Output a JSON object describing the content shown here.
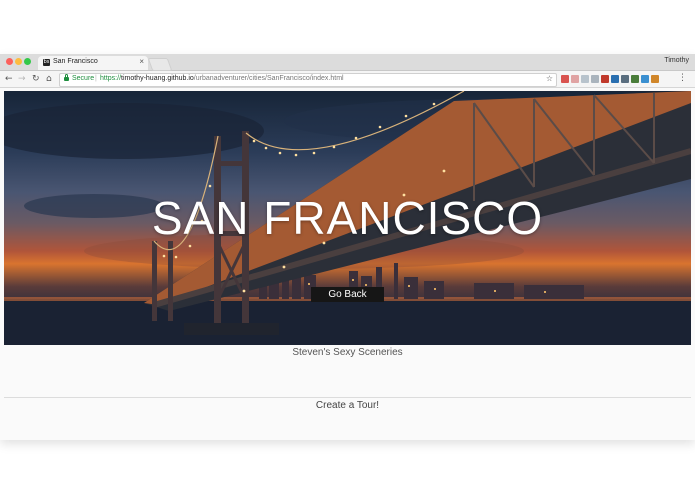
{
  "browser": {
    "tab_title": "San Francisco",
    "tab_favicon_text": "bs",
    "profile_name": "Timothy",
    "security_label": "Secure",
    "url_scheme": "https://",
    "url_host": "timothy-huang.github.io",
    "url_path": "/urbanadventurer/cities/SanFrancisco/index.html",
    "extension_colors": [
      "#d9534f",
      "#e0a3a3",
      "#b8c3cc",
      "#aab4bd",
      "#c0392b",
      "#2a6fb0",
      "#5a6e7f",
      "#4a7d3a",
      "#3a8fd0",
      "#d0862a"
    ]
  },
  "hero": {
    "title": "SAN FRANCISCO",
    "button_label": "Go Back"
  },
  "content": {
    "subtitle": "Steven's Sexy Sceneries",
    "tour_link": "Create a Tour!"
  }
}
